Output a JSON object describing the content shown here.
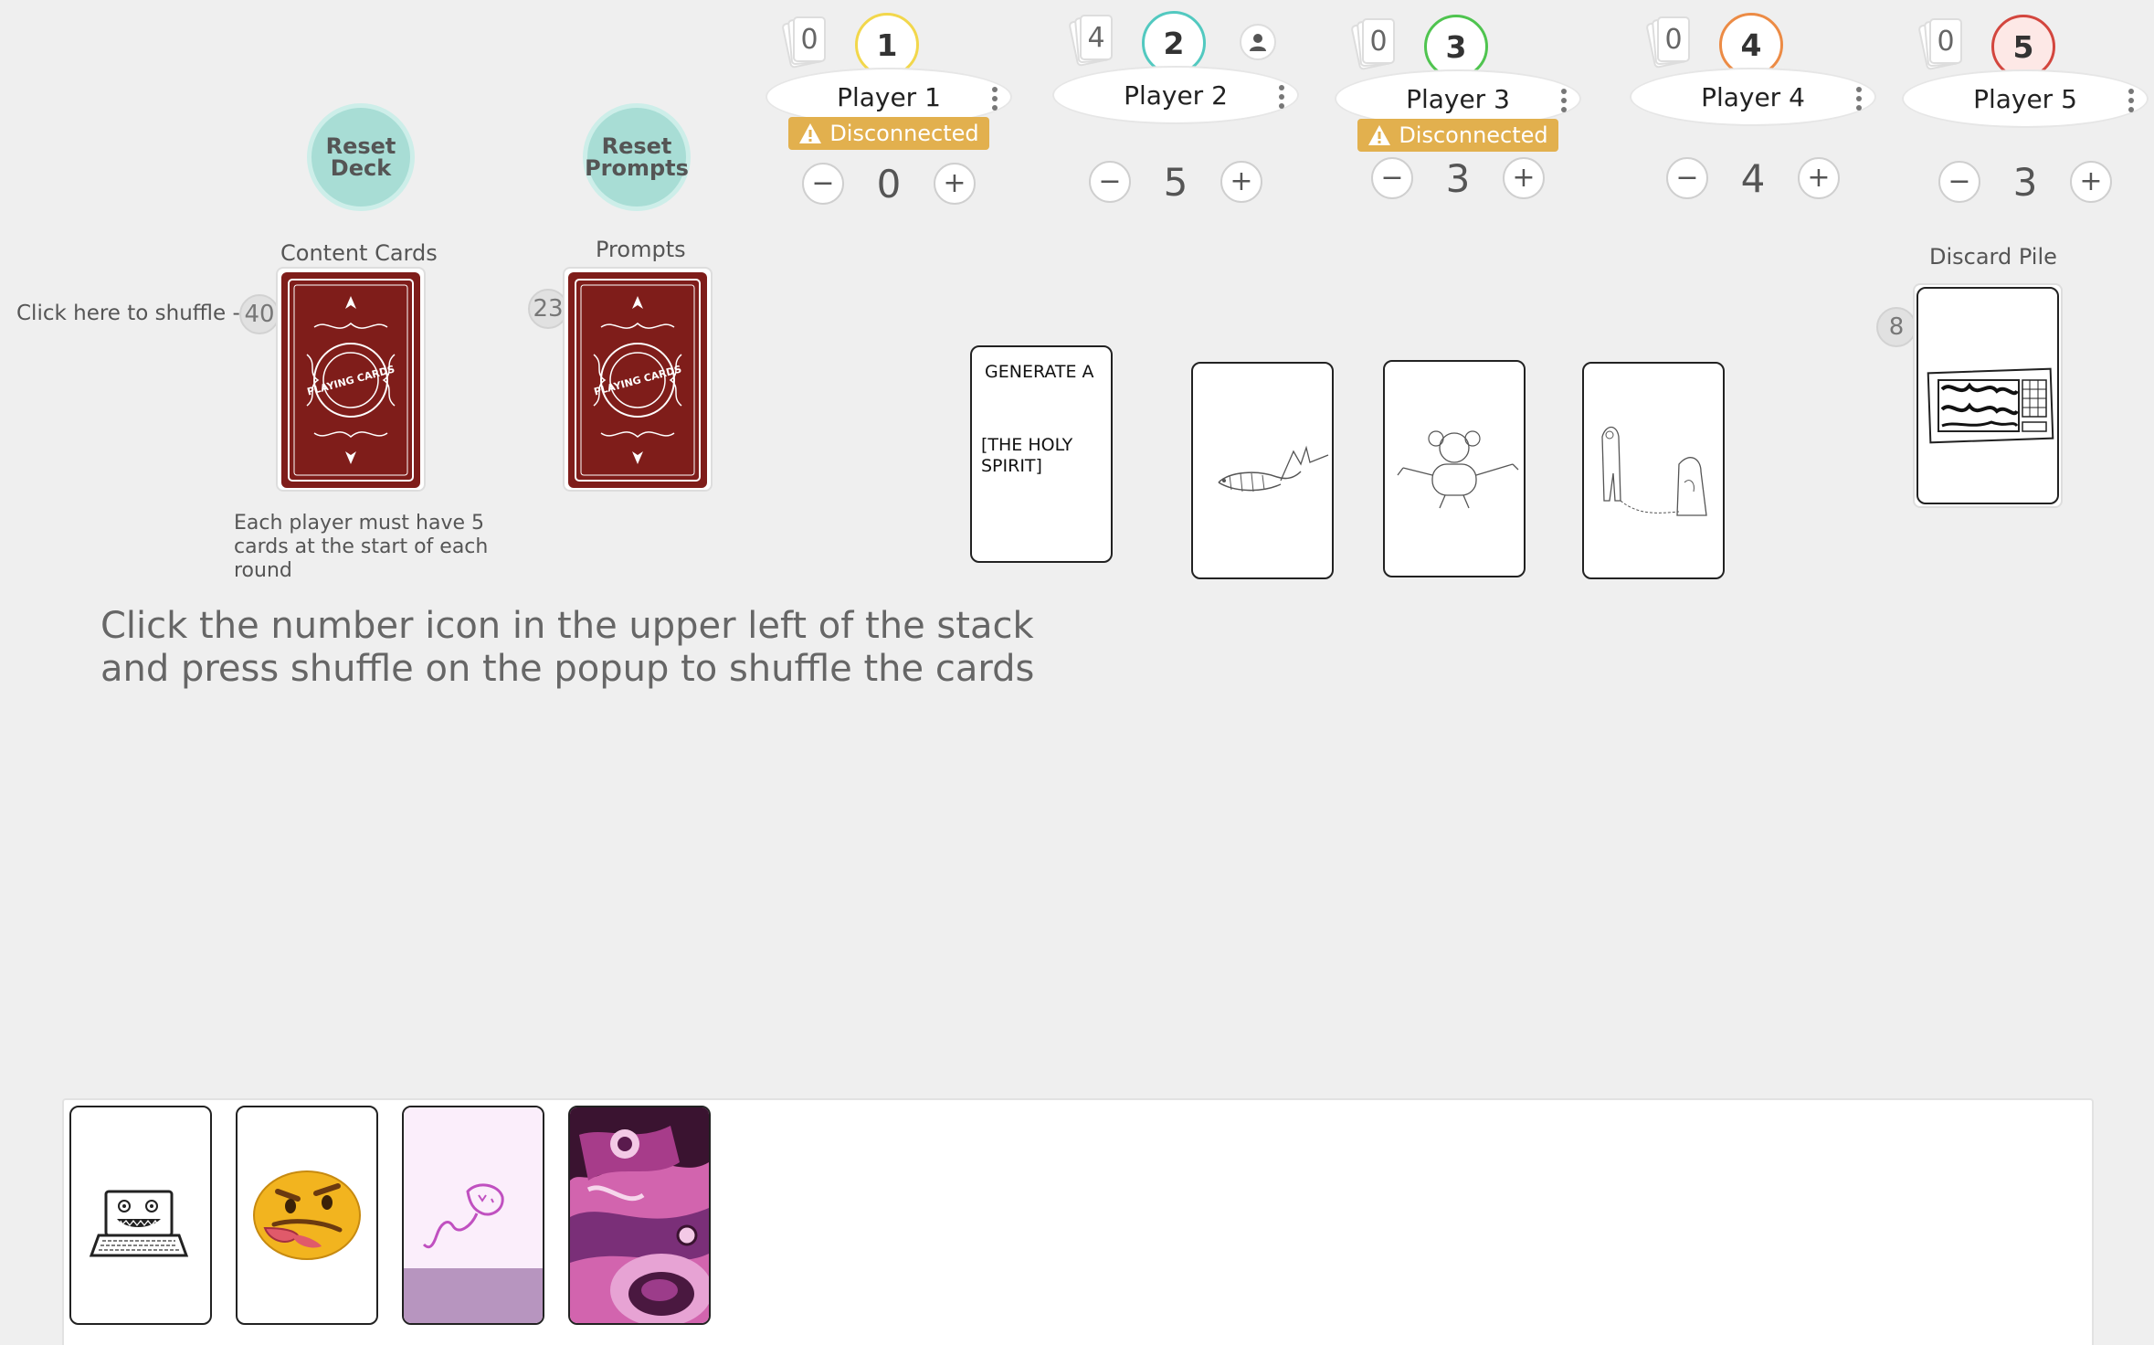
{
  "players": [
    {
      "name": "Player 1",
      "number": "1",
      "hand_count": "0",
      "score": "0",
      "disconnected": true,
      "color": "#f2d74b"
    },
    {
      "name": "Player 2",
      "number": "2",
      "hand_count": "4",
      "score": "5",
      "disconnected": false,
      "color": "#52c9c0",
      "is_self": true
    },
    {
      "name": "Player 3",
      "number": "3",
      "hand_count": "0",
      "score": "3",
      "disconnected": true,
      "color": "#4fc44f"
    },
    {
      "name": "Player 4",
      "number": "4",
      "hand_count": "0",
      "score": "4",
      "disconnected": false,
      "color": "#ec8b45"
    },
    {
      "name": "Player 5",
      "number": "5",
      "hand_count": "0",
      "score": "3",
      "disconnected": false,
      "color": "#d3463e"
    }
  ],
  "status": {
    "disconnected_label": "Disconnected"
  },
  "stepper": {
    "minus": "−",
    "plus": "+"
  },
  "buttons": {
    "reset_deck": "Reset Deck",
    "reset_prompts": "Reset Prompts"
  },
  "content_deck": {
    "label": "Content Cards",
    "count": "40",
    "back_text": "PLAYING CARDS"
  },
  "prompts_deck": {
    "label": "Prompts",
    "count": "23",
    "back_text": "PLAYING CARDS"
  },
  "discard": {
    "label": "Discard Pile",
    "count": "8"
  },
  "hints": {
    "shuffle_arrow": "Click here to shuffle -->",
    "five_cards": "Each player must have 5 cards at the start of each round",
    "instruction_line1": "Click the number icon in the upper left of the stack",
    "instruction_line2": "and press shuffle on the popup to shuffle the cards"
  },
  "prompt_card": {
    "line1": "GENERATE A",
    "line2": "[THE HOLY SPIRIT]"
  },
  "colors": {
    "background": "#efefef",
    "deck_back": "#7f1d1a",
    "reset_button": "#a8ddd5",
    "disconnected": "#e2b04e"
  }
}
